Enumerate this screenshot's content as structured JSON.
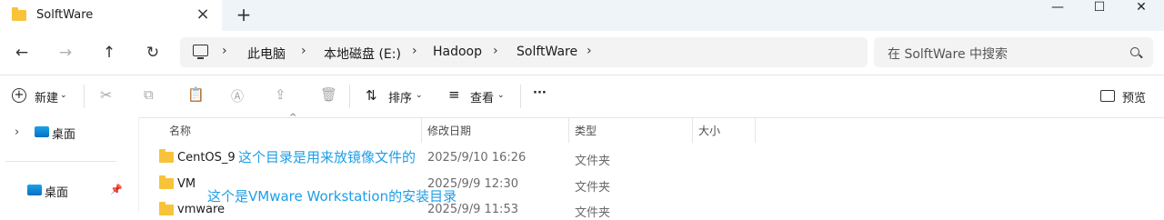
{
  "window": {
    "tab_title": "SolftWare",
    "new_tab": "+",
    "minimize": "—",
    "maximize": "☐",
    "close": "✕"
  },
  "breadcrumb": [
    "此电脑",
    "本地磁盘 (E:)",
    "Hadoop",
    "SolftWare"
  ],
  "search": {
    "placeholder": "在 SolftWare 中搜索"
  },
  "toolbar": {
    "new_label": "新建",
    "sort_label": "排序",
    "view_label": "查看",
    "more_label": "···",
    "preview_label": "预览"
  },
  "nav_pane": {
    "items": [
      {
        "label": "桌面"
      },
      {
        "label": "桌面"
      }
    ]
  },
  "columns": {
    "name": "名称",
    "modified": "修改日期",
    "type": "类型",
    "size": "大小"
  },
  "files": [
    {
      "name": "CentOS_9",
      "modified": "2025/9/10 16:26",
      "type": "文件夹"
    },
    {
      "name": "VM",
      "modified": "2025/9/9 12:30",
      "type": "文件夹"
    },
    {
      "name": "vmware",
      "modified": "2025/9/9 11:53",
      "type": "文件夹"
    }
  ],
  "annotations": {
    "centos": "这个目录是用来放镜像文件的",
    "vm": "这个是VMware Workstation的安装目录"
  },
  "colors": {
    "accent": "#1e9ee6",
    "folder": "#f8c33a"
  }
}
